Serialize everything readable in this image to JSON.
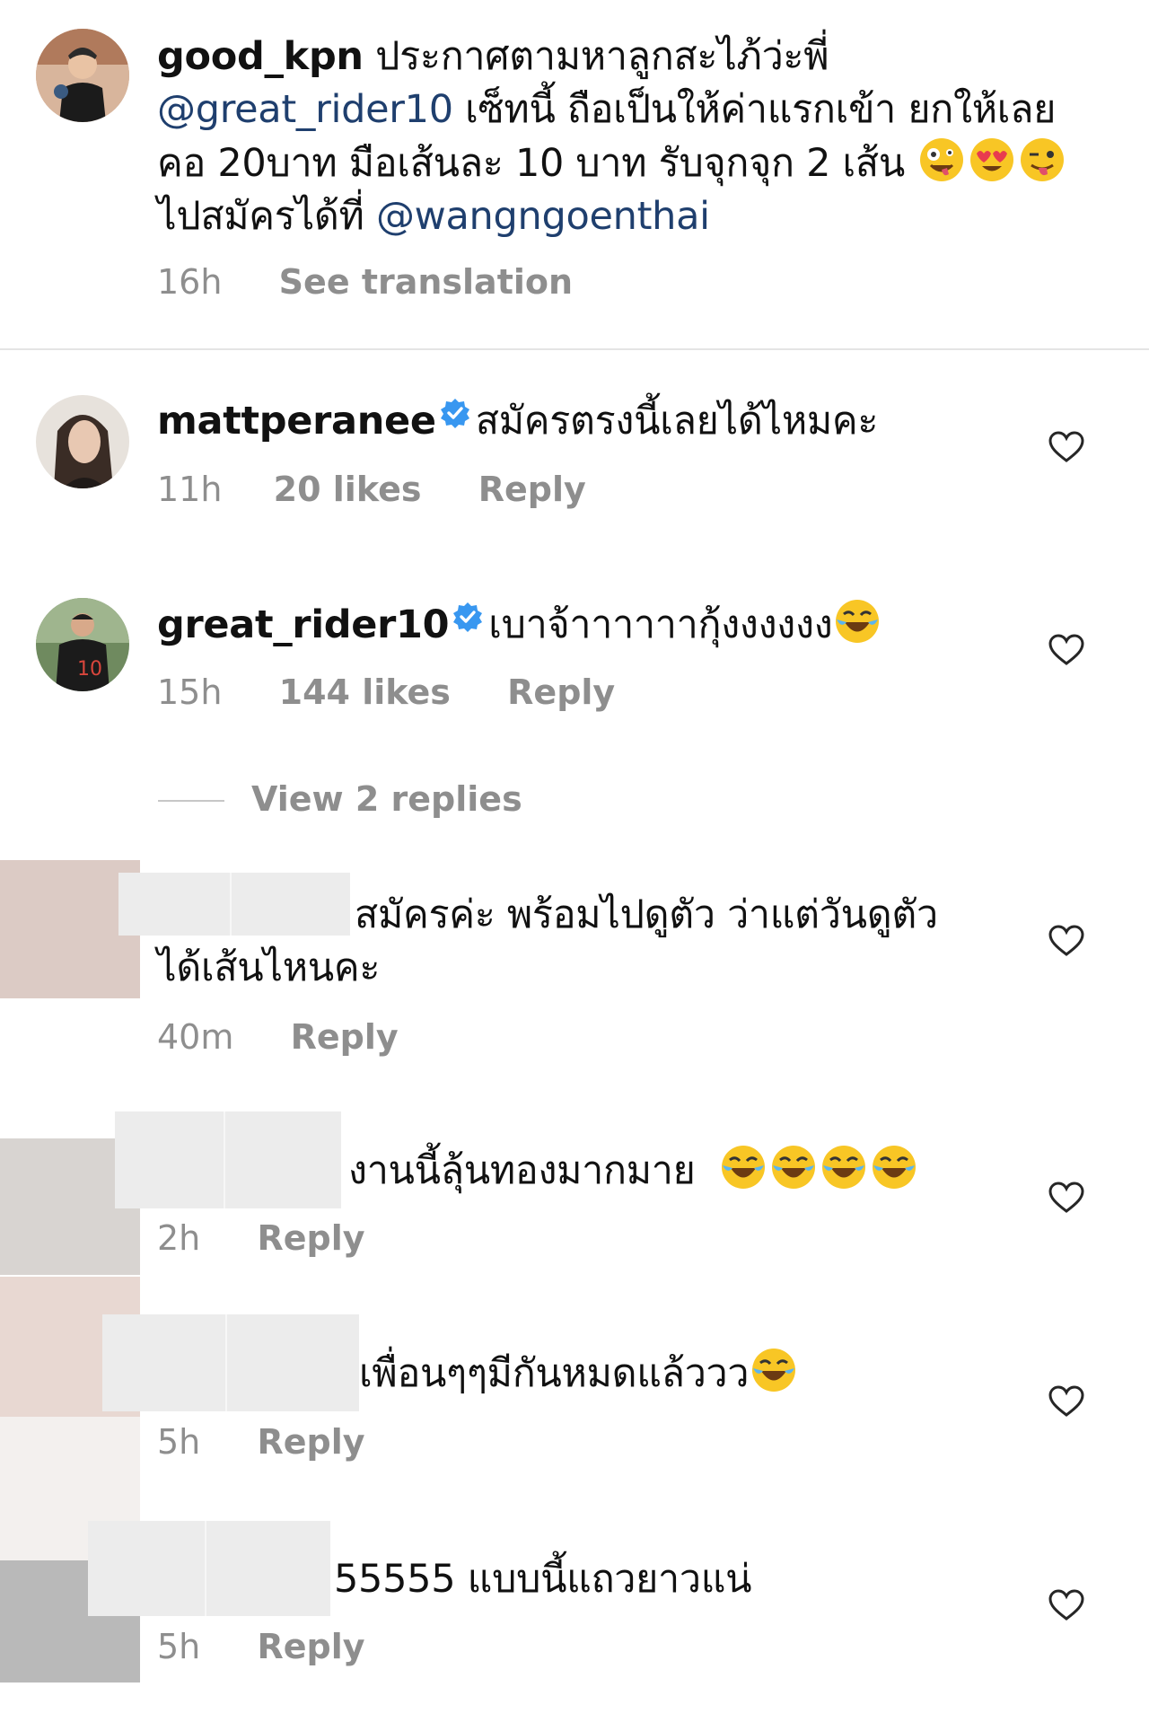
{
  "post_caption": {
    "username": "good_kpn",
    "line1_text": " ประกาศตามหาลูกสะไภ้ว่ะพี่",
    "mention1": "@great_rider10",
    "line2_text": " เซ็ทนี้ ถือเป็นให้ค่าแรกเข้า ยกให้เลย",
    "line3_text": "คอ 20บาท มือเส้นละ 10 บาท รับจุกจุก 2 เส้น",
    "line4_text": "ไปสมัครได้ที่ ",
    "mention2": "@wangngoenthai",
    "time": "16h",
    "see_translation": "See translation",
    "emojis": [
      "zany-face-emoji",
      "heart-eyes-emoji",
      "winking-tongue-emoji"
    ]
  },
  "comments": [
    {
      "username": "mattperanee",
      "verified": true,
      "text": "สมัครตรงนี้เลยได้ไหมคะ",
      "time": "11h",
      "likes": "20 likes",
      "reply": "Reply"
    },
    {
      "username": "great_rider10",
      "verified": true,
      "text": "เบาจ้าาาาาากุ้งงงงงง",
      "time": "15h",
      "likes": "144 likes",
      "reply": "Reply",
      "view_replies": "View 2 replies"
    },
    {
      "text_line1": "สมัครค่ะ พร้อมไปดูตัว ว่าแต่วันดูตัว",
      "text_line2": "ได้เส้นไหนคะ",
      "time": "40m",
      "reply": "Reply"
    },
    {
      "text": "งานนี้ลุ้นทองมากมาย",
      "time": "2h",
      "reply": "Reply"
    },
    {
      "text": "เพื่อนๆๆมีกันหมดแล้ววว",
      "time": "5h",
      "reply": "Reply"
    },
    {
      "text": "55555 แบบนี้แถวยาวแน่",
      "time": "5h",
      "reply": "Reply"
    }
  ],
  "colors": {
    "mention": "#1f3f6e",
    "meta_gray": "#8e8e8e",
    "verified_blue": "#3897f0",
    "divider": "#e4e4e4"
  }
}
